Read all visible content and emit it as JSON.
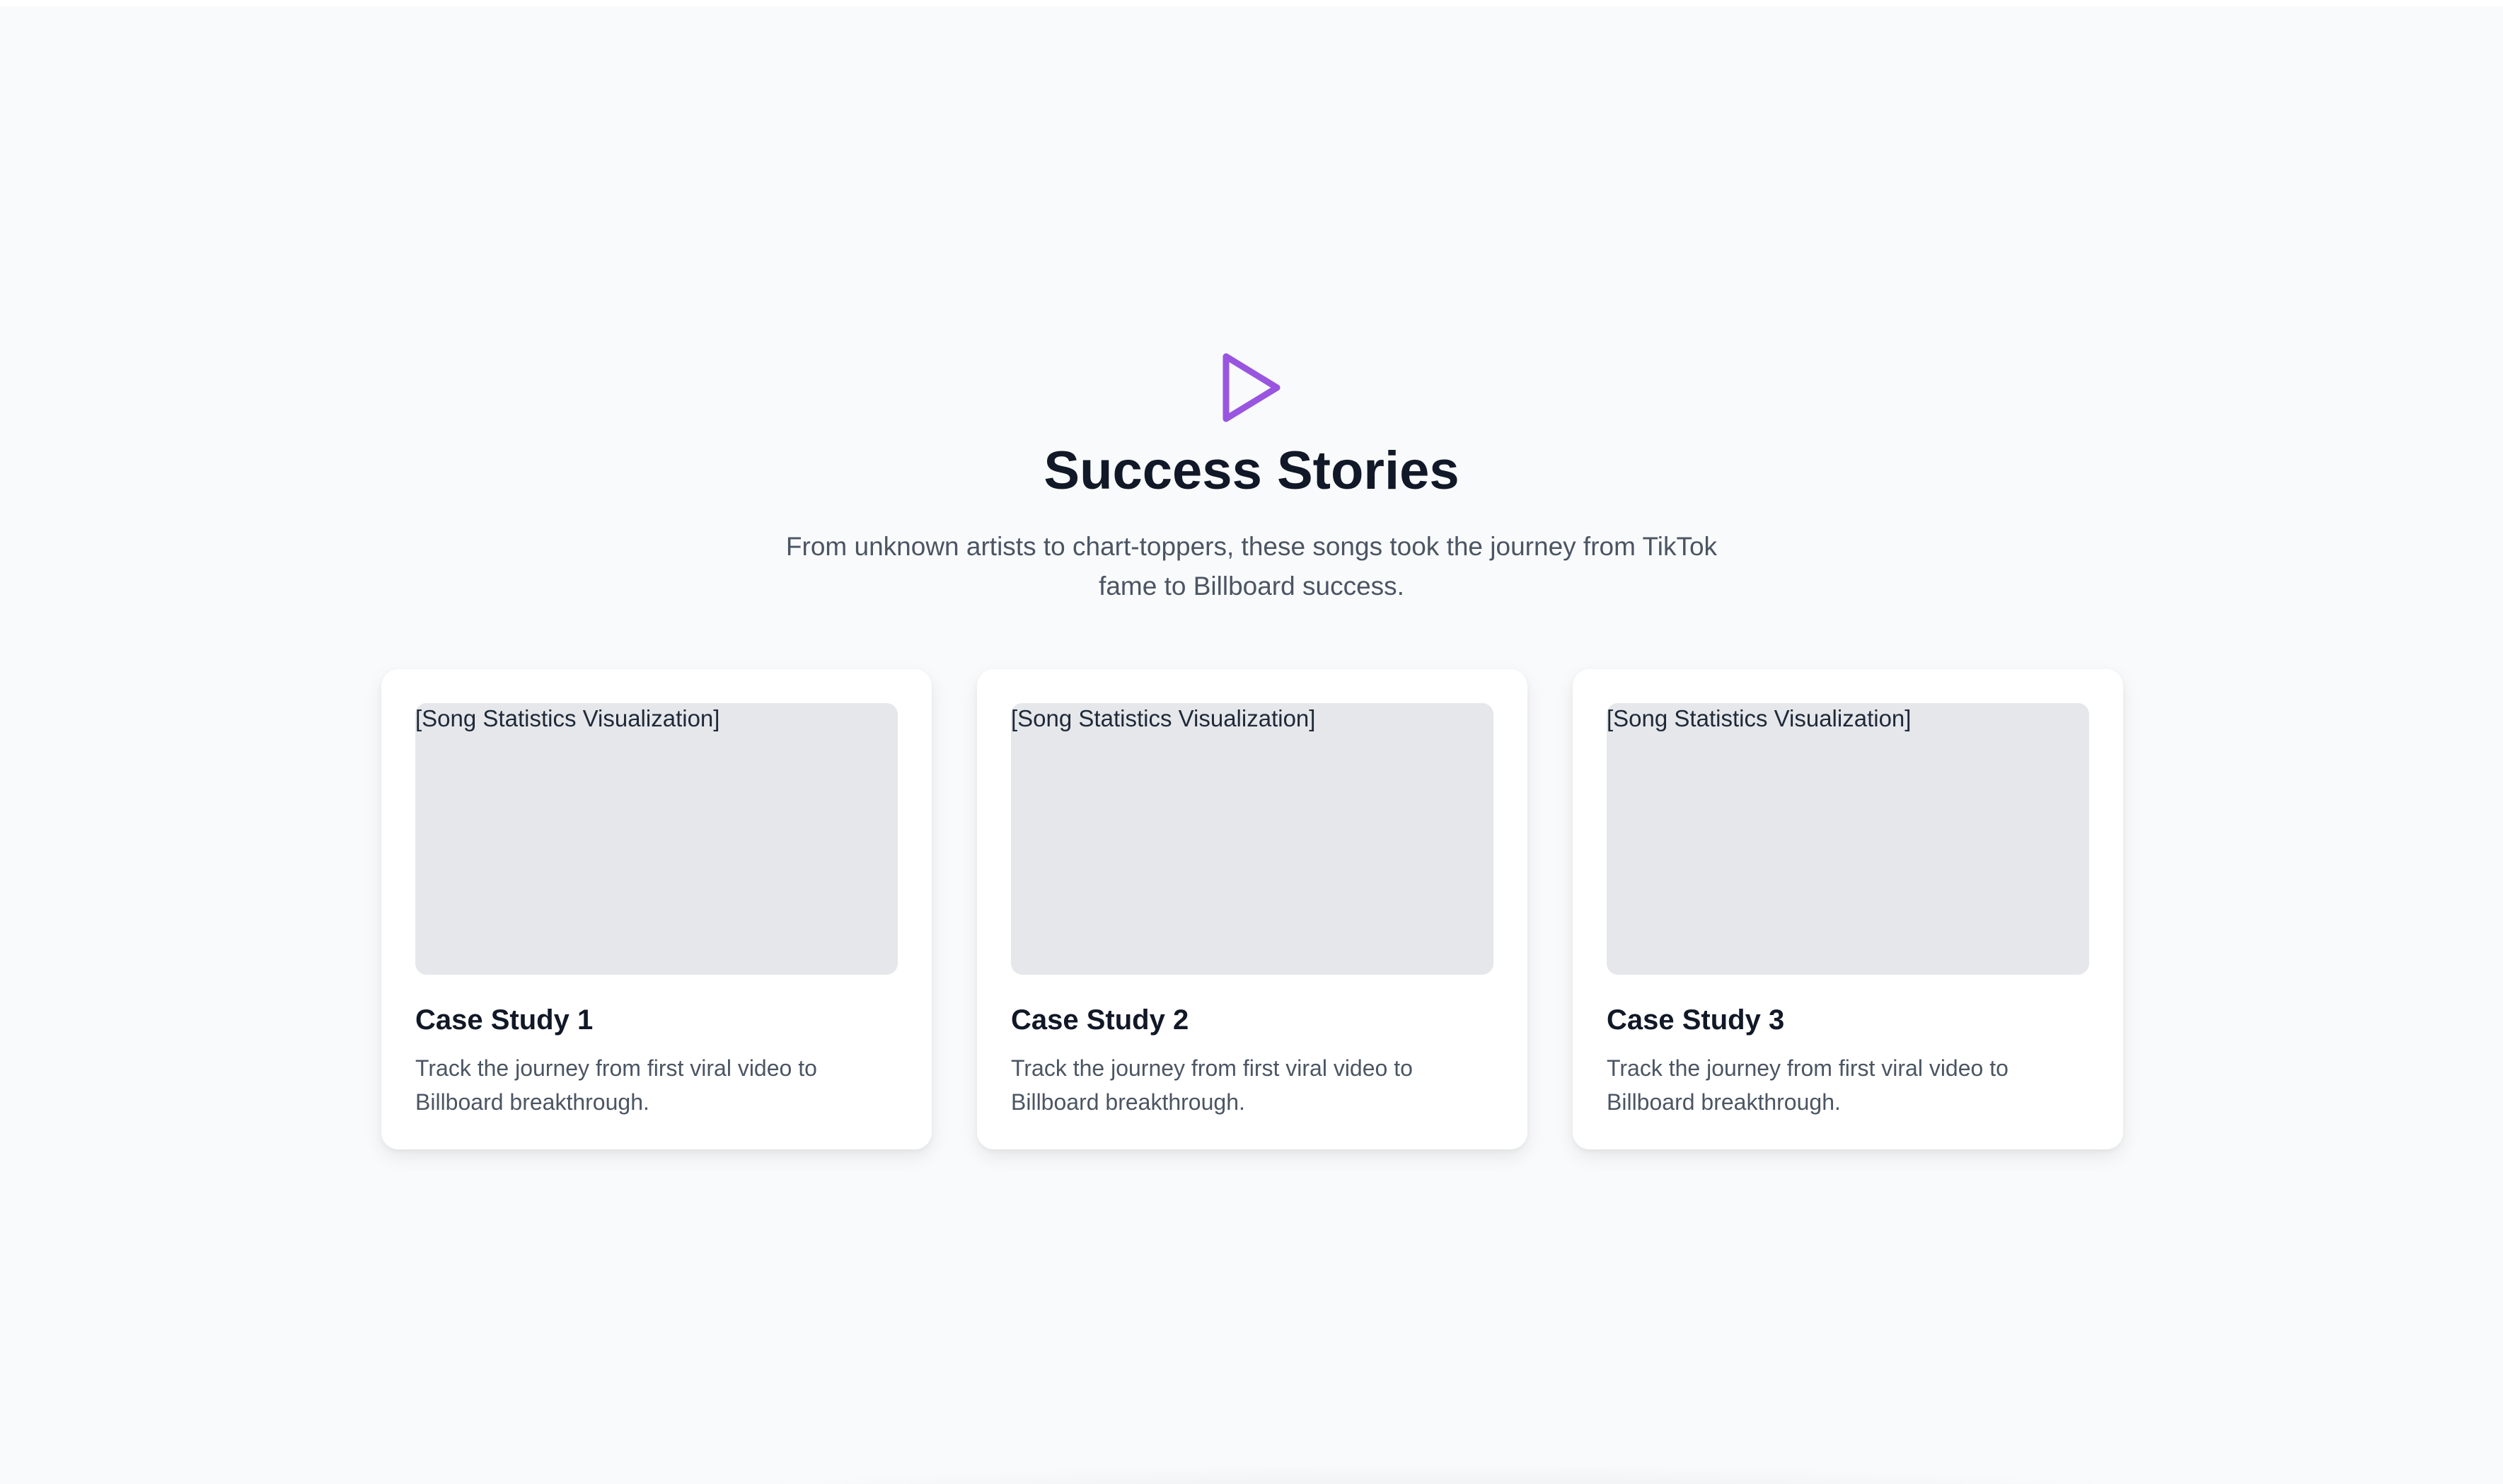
{
  "hero": {
    "icon": "play-icon",
    "accent_color": "#9955e0",
    "title": "Success Stories",
    "subtitle": "From unknown artists to chart-toppers, these songs took the journey from TikTok fame to Billboard success."
  },
  "cards": [
    {
      "visual_label": "[Song Statistics Visualization]",
      "title": "Case Study 1",
      "description": "Track the journey from first viral video to Billboard breakthrough."
    },
    {
      "visual_label": "[Song Statistics Visualization]",
      "title": "Case Study 2",
      "description": "Track the journey from first viral video to Billboard breakthrough."
    },
    {
      "visual_label": "[Song Statistics Visualization]",
      "title": "Case Study 3",
      "description": "Track the journey from first viral video to Billboard breakthrough."
    }
  ]
}
